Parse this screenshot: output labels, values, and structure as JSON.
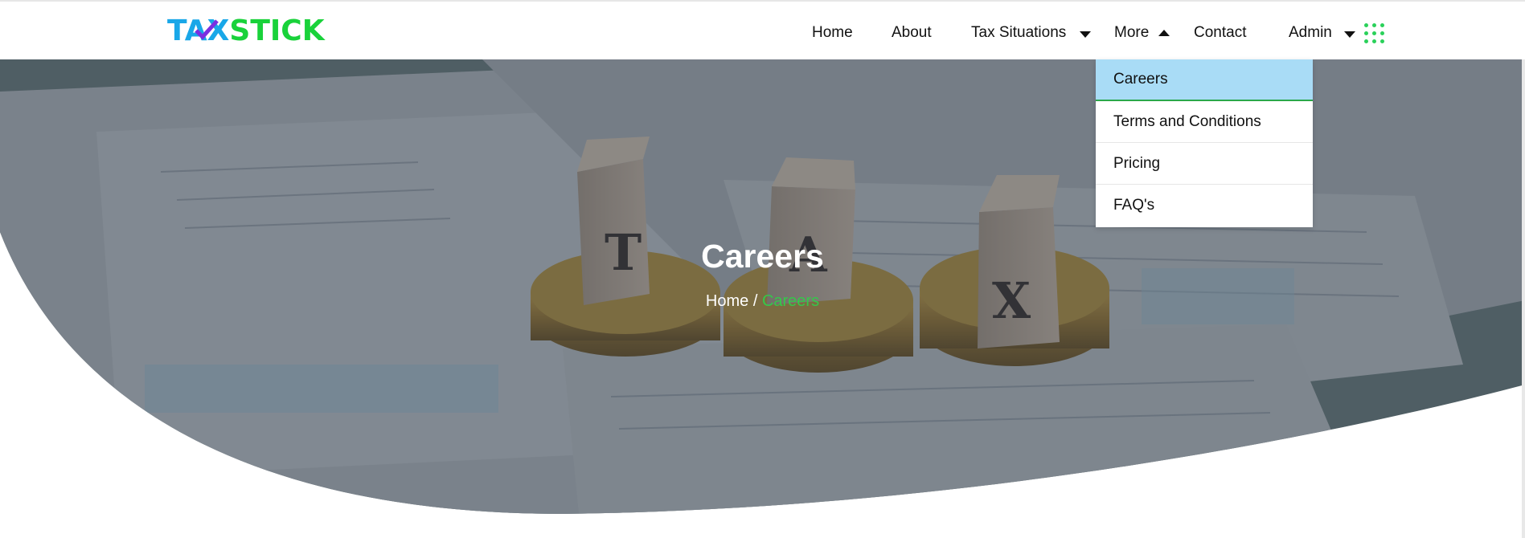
{
  "brand": {
    "part1": "TAX",
    "part2": "STICK",
    "color1": "#19a7e8",
    "color2": "#19d23a"
  },
  "nav": {
    "home": "Home",
    "about": "About",
    "tax_situations": "Tax Situations",
    "more": "More",
    "contact": "Contact",
    "admin": "Admin"
  },
  "dropdown": {
    "items": [
      "Careers",
      "Terms and Conditions",
      "Pricing",
      "FAQ's"
    ],
    "active": "Careers"
  },
  "hero": {
    "title": "Careers",
    "breadcrumb_home": "Home",
    "breadcrumb_sep": " / ",
    "breadcrumb_current": "Careers",
    "accent": "#35c84a",
    "blocks": [
      "T",
      "A",
      "X"
    ]
  }
}
